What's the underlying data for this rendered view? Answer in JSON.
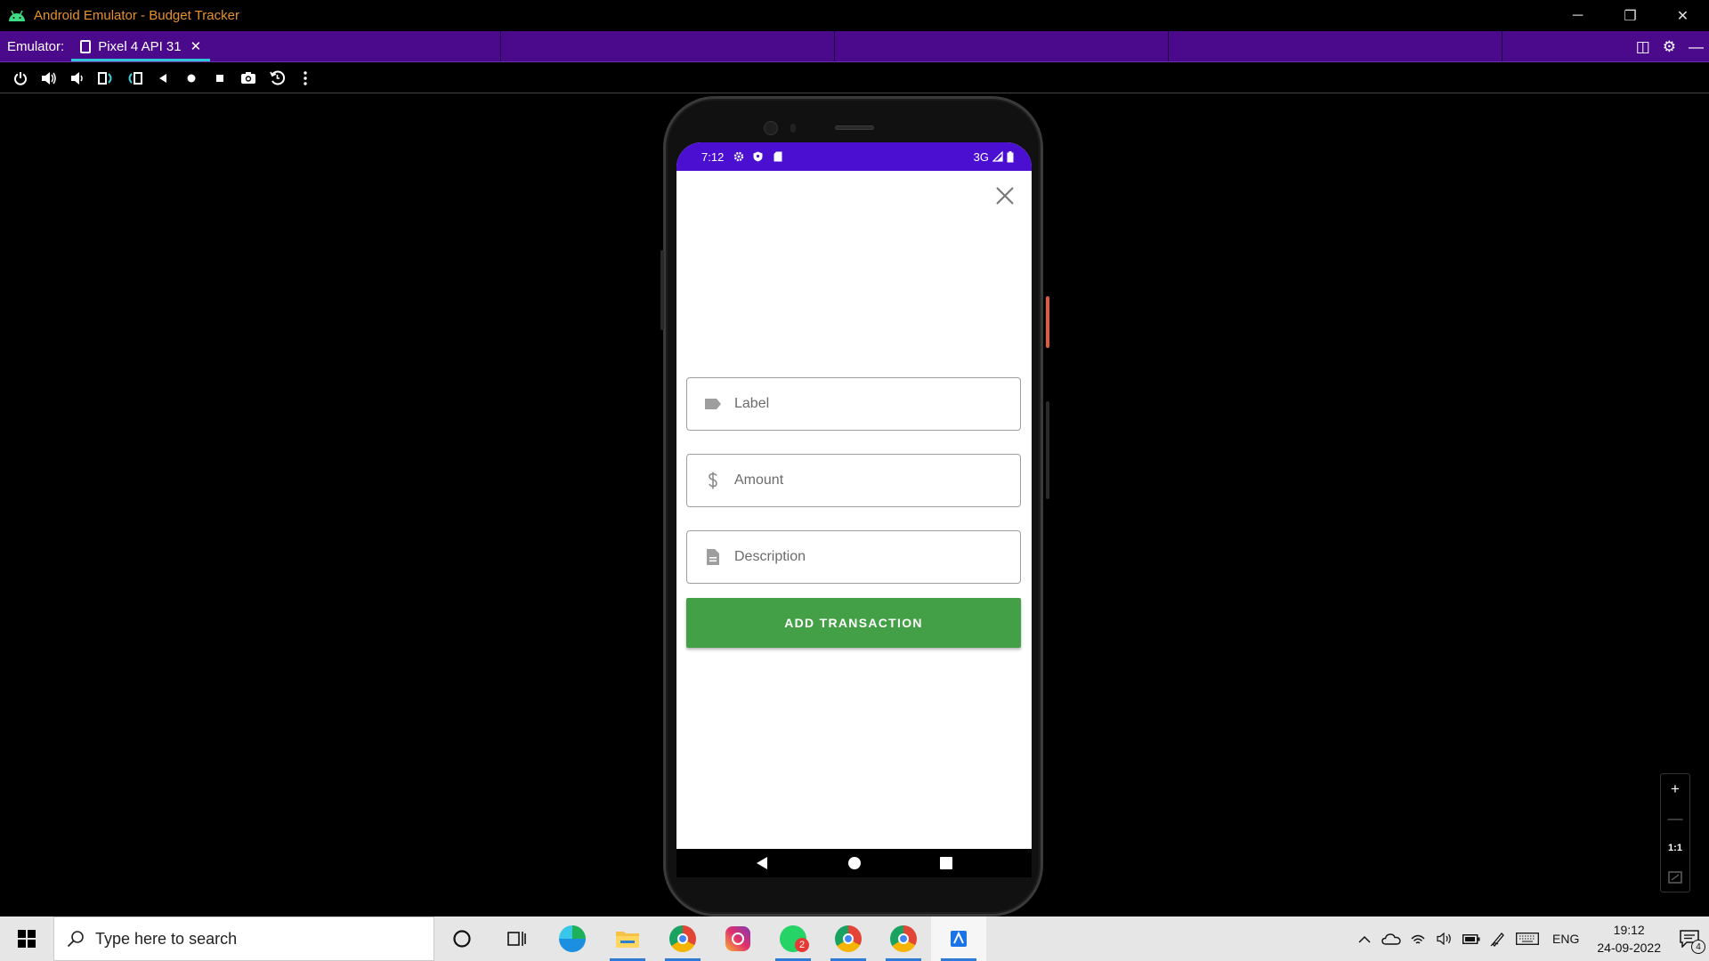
{
  "window": {
    "title": "Android Emulator - Budget Tracker",
    "minimize": "─",
    "restore": "❐",
    "close": "✕"
  },
  "tabbar": {
    "label": "Emulator:",
    "tab_name": "Pixel 4 API 31",
    "tab_close": "✕"
  },
  "toolbar": {
    "tools": [
      "power-icon",
      "volume-up-icon",
      "volume-down-icon",
      "rotate-left-icon",
      "rotate-right-icon",
      "back-icon",
      "home-icon",
      "overview-icon",
      "camera-icon",
      "snapshot-icon",
      "more-icon"
    ]
  },
  "device": {
    "status": {
      "time": "7:12",
      "network": "3G"
    },
    "form": {
      "label_placeholder": "Label",
      "amount_placeholder": "Amount",
      "description_placeholder": "Description",
      "submit_label": "ADD TRANSACTION"
    },
    "colors": {
      "status_bar": "#4a0fd0",
      "button": "#43a047"
    }
  },
  "zoom": {
    "zoom_in": "+",
    "zoom_out": "—",
    "actual_size": "1:1"
  },
  "taskbar": {
    "search_placeholder": "Type here to search",
    "whatsapp_badge": "2",
    "language": "ENG",
    "time": "19:12",
    "date": "24-09-2022",
    "notification_count": "4"
  }
}
